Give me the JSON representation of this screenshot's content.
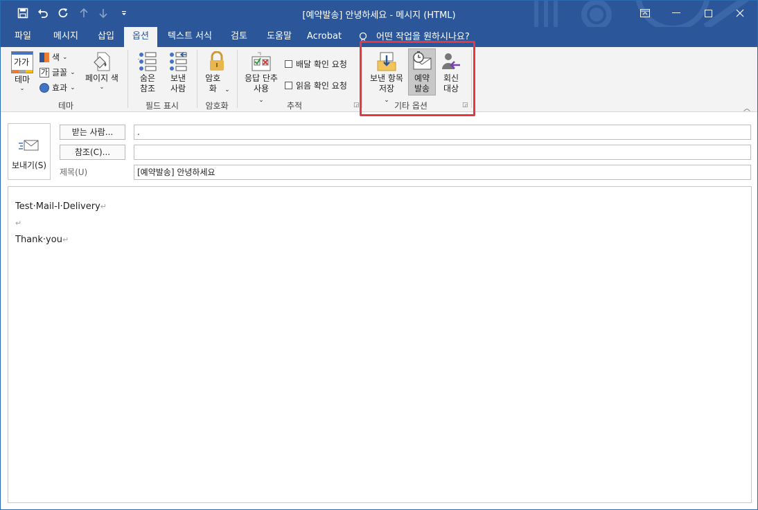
{
  "window": {
    "title": "[예약발송] 안녕하세요  -  메시지 (HTML)"
  },
  "tabs": [
    "파일",
    "메시지",
    "삽입",
    "옵션",
    "텍스트 서식",
    "검토",
    "도움말",
    "Acrobat"
  ],
  "active_tab": "옵션",
  "tell_me": "어떤 작업을 원하시나요?",
  "ribbon": {
    "theme": {
      "theme_label": "테마",
      "colors_label": "색",
      "fonts_label": "글꼴",
      "effects_label": "효과",
      "page_color_label": "페이지 색",
      "group_label": "테마",
      "theme_icon_text": "가가",
      "font_icon_text": "가"
    },
    "fields": {
      "bcc_label": "숨은 참조",
      "from_label": "보낸 사람",
      "group_label": "필드 표시"
    },
    "encrypt": {
      "encrypt_label": "암호화",
      "group_label": "암호화"
    },
    "tracking": {
      "voting_label": "응답 단추 사용",
      "delivery_receipt_label": "배달 확인 요청",
      "read_receipt_label": "읽음 확인 요청",
      "group_label": "추적"
    },
    "more_options": {
      "save_sent_label": "보낸 항목 저장",
      "delay_delivery_label": "예약 발송",
      "direct_replies_label": "회신 대상",
      "group_label": "기타 옵션"
    }
  },
  "compose": {
    "send_label": "보내기(S)",
    "to_button": "받는 사람...",
    "to_value": ".",
    "cc_button": "참조(C)...",
    "cc_value": "",
    "subject_label": "제목(U)",
    "subject_value": "[예약발송] 안녕하세요",
    "body": {
      "line1": "Test·Mail-I·Delivery",
      "line2": "",
      "line3": "Thank·you"
    },
    "pilcrow": "↵"
  },
  "colors": {
    "title_bar": "#2b579a",
    "highlight": "#e8383d",
    "ribbon_bg": "#f3f3f3"
  }
}
